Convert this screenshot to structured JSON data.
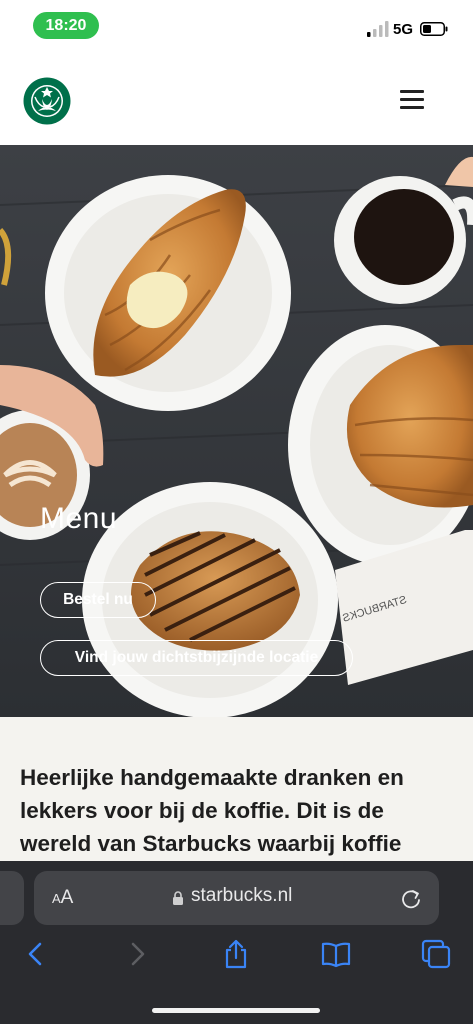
{
  "status_bar": {
    "time": "18:20",
    "network": "5G"
  },
  "header": {
    "logo": "starbucks-siren-logo",
    "menu_icon": "hamburger-menu-icon"
  },
  "hero": {
    "title": "Menu",
    "order_button": "Bestel nu",
    "locate_button": "Vind jouw dichtstbijzijnde locatie"
  },
  "content": {
    "intro": "Heerlijke handgemaakte dranken en lekkers voor bij de koffie. Dit is de wereld van Starbucks waarbij koffie"
  },
  "browser": {
    "text_size_small": "A",
    "text_size_big": "A",
    "url": "starbucks.nl",
    "icons": [
      "back-icon",
      "forward-icon",
      "share-icon",
      "bookmarks-icon",
      "tabs-icon"
    ]
  },
  "colors": {
    "status_pill": "#2fbf4f",
    "starbucks_green": "#00704a",
    "browser_bg": "#2a2b2f",
    "ios_blue": "#3a84f6"
  }
}
